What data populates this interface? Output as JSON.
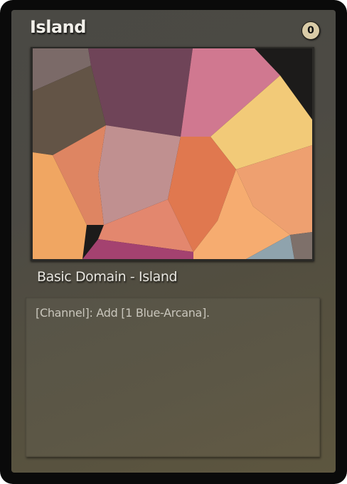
{
  "card": {
    "name": "Island",
    "mana_cost": "0",
    "type_line": "Basic Domain - Island",
    "rules_text": "[Channel]: Add [1 Blue-Arcana].",
    "art": {
      "style": "voronoi-mosaic",
      "colors": [
        "#7b6a68",
        "#6f4458",
        "#d07890",
        "#635446",
        "#f2ca78",
        "#c09090",
        "#e0845e",
        "#e27758",
        "#eea070",
        "#f4a35e",
        "#e3876e",
        "#f6ac70",
        "#a44270",
        "#8fa3ad",
        "#1c1b1a"
      ]
    }
  }
}
